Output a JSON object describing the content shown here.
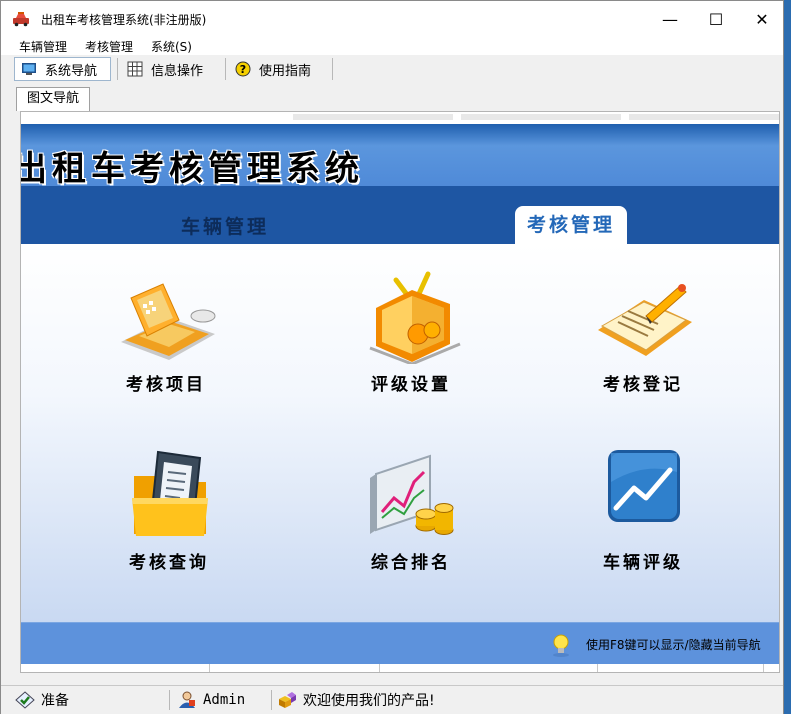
{
  "window": {
    "title": "出租车考核管理系统(非注册版)",
    "controls": {
      "minimize": "—",
      "maximize": "☐",
      "close": "✕"
    }
  },
  "menubar": {
    "items": [
      "车辆管理",
      "考核管理",
      "系统(S)"
    ]
  },
  "toolbar": {
    "buttons": [
      {
        "label": "系统导航",
        "icon": "monitor-icon",
        "active": true
      },
      {
        "label": "信息操作",
        "icon": "grid-icon",
        "active": false
      },
      {
        "label": "使用指南",
        "icon": "help-icon",
        "active": false
      }
    ]
  },
  "doc_tabs": [
    "图文导航"
  ],
  "banner": {
    "title": "出租车考核管理系统"
  },
  "nav_tabs": [
    {
      "label": "车辆管理",
      "selected": false
    },
    {
      "label": "考核管理",
      "selected": true
    }
  ],
  "items": [
    {
      "label": "考核项目",
      "icon": "laptop-icon"
    },
    {
      "label": "评级设置",
      "icon": "tv-award-icon"
    },
    {
      "label": "考核登记",
      "icon": "clipboard-pen-icon"
    },
    {
      "label": "考核查询",
      "icon": "folder-document-icon"
    },
    {
      "label": "综合排名",
      "icon": "chart-coins-icon"
    },
    {
      "label": "车辆评级",
      "icon": "trend-chart-icon"
    }
  ],
  "hint": {
    "text": "使用F8键可以显示/隐藏当前导航"
  },
  "statusbar": {
    "status": "准备",
    "user": "Admin",
    "message": "欢迎使用我们的产品!"
  },
  "colors": {
    "header_blue": "#1e56a3",
    "accent_blue": "#2468b8",
    "footer_blue": "#5d92dc"
  }
}
